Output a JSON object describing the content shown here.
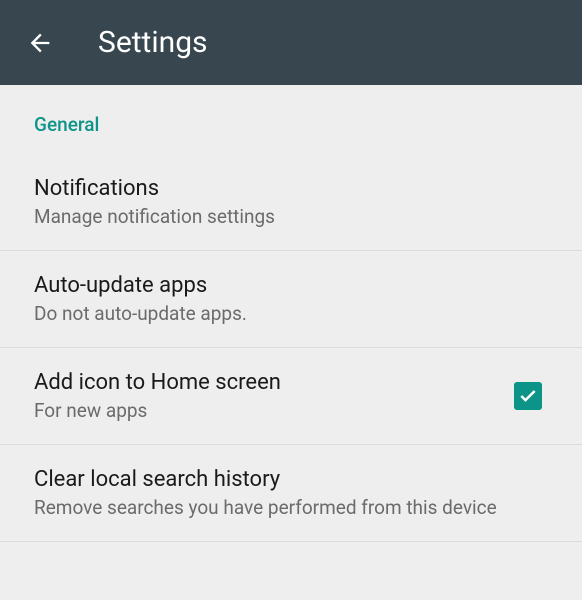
{
  "header": {
    "title": "Settings"
  },
  "section": {
    "label": "General"
  },
  "items": [
    {
      "title": "Notifications",
      "subtitle": "Manage notification settings"
    },
    {
      "title": "Auto-update apps",
      "subtitle": "Do not auto-update apps."
    },
    {
      "title": "Add icon to Home screen",
      "subtitle": "For new apps",
      "checked": true
    },
    {
      "title": "Clear local search history",
      "subtitle": "Remove searches you have performed from this device"
    }
  ]
}
